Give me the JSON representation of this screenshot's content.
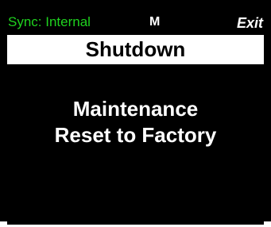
{
  "status_bar": {
    "sync_label": "Sync: Internal",
    "mode_indicator": "M",
    "exit_label": "Exit"
  },
  "header": {
    "title": "Shutdown"
  },
  "menu": {
    "items": [
      {
        "label": "Maintenance"
      },
      {
        "label": "Reset to Factory"
      }
    ]
  },
  "colors": {
    "background": "#000000",
    "sync_text": "#1fd21f",
    "title_bar": "#ffffff",
    "text": "#ffffff"
  }
}
